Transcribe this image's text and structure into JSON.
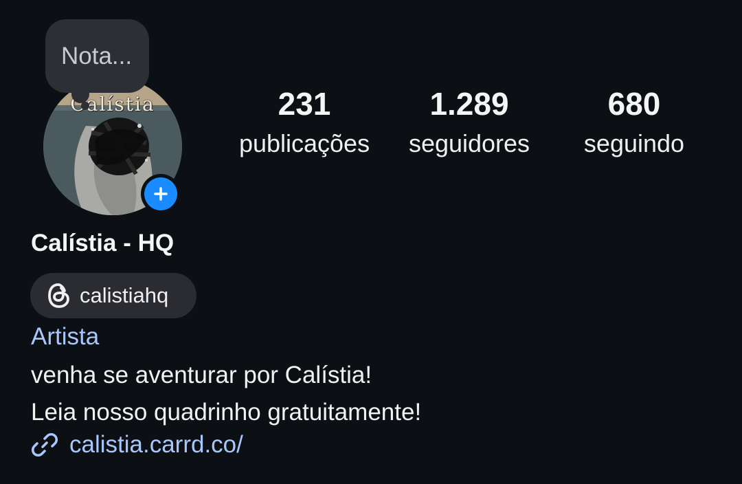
{
  "note": {
    "label": "Nota..."
  },
  "avatar": {
    "art_title": "Calístia"
  },
  "stats": [
    {
      "value": "231",
      "label": "publicações"
    },
    {
      "value": "1.289",
      "label": "seguidores"
    },
    {
      "value": "680",
      "label": "seguindo"
    }
  ],
  "profile": {
    "name": "Calístia - HQ",
    "threads_handle": "calistiahq",
    "category": "Artista",
    "bio_lines": [
      "venha se aventurar por Calístia!",
      "Leia nosso quadrinho gratuitamente!"
    ],
    "link": "calistia.carrd.co/"
  },
  "colors": {
    "background": "#0c0f14",
    "accent_link": "#a8c7fa",
    "add_button": "#1a8cff",
    "pill": "#2a2c31",
    "note_bubble": "#2d2f34"
  },
  "icons": {
    "add": "plus-icon",
    "threads": "threads-icon",
    "link": "link-icon"
  }
}
